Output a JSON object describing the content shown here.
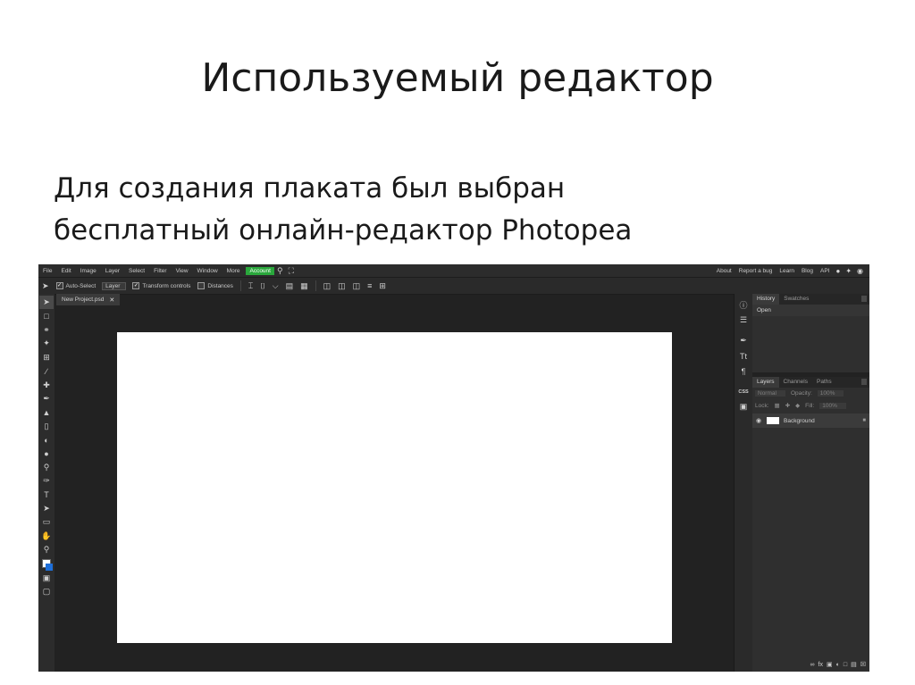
{
  "slide": {
    "title": "Используемый редактор",
    "body_line1": "Для создания плаката был выбран",
    "body_line2": "бесплатный онлайн-редактор Photopea"
  },
  "app": {
    "menu": [
      "File",
      "Edit",
      "Image",
      "Layer",
      "Select",
      "Filter",
      "View",
      "Window",
      "More"
    ],
    "account_label": "Account",
    "right_links": [
      "About",
      "Report a bug",
      "Learn",
      "Blog",
      "API"
    ],
    "options": {
      "auto_select_label": "Auto-Select",
      "layer_dropdown": "Layer",
      "transform_controls_label": "Transform controls",
      "distances_label": "Distances"
    },
    "document_tab": "New Project.psd",
    "history_panel": {
      "tabs": [
        "History",
        "Swatches"
      ],
      "entries": [
        "Open"
      ]
    },
    "layers_panel": {
      "tabs": [
        "Layers",
        "Channels",
        "Paths"
      ],
      "blend_mode": "Normal",
      "opacity_label": "Opacity:",
      "opacity_value": "100%",
      "lock_label": "Lock:",
      "fill_label": "Fill:",
      "fill_value": "100%",
      "layers": [
        {
          "name": "Background"
        }
      ]
    },
    "side_strip_label": "CSS",
    "colors": {
      "accent": "#2aa83c",
      "background_swatch": "#1e6fd9",
      "foreground_swatch": "#ffffff"
    }
  }
}
